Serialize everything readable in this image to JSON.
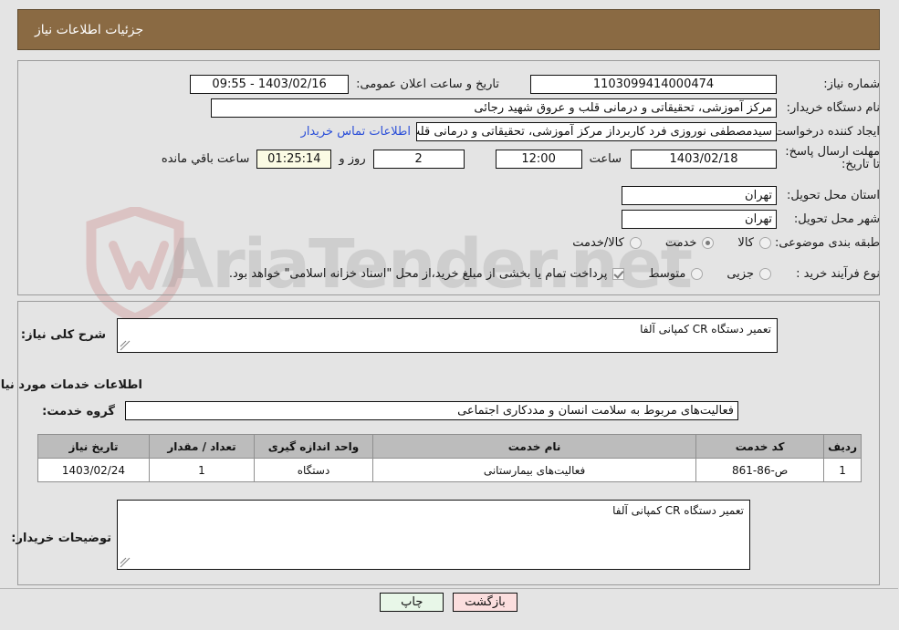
{
  "header": {
    "title": "جزئیات اطلاعات نیاز"
  },
  "colors": {
    "header_bg": "#8a6a43",
    "header_text": "#ffffff",
    "page_bg": "#e4e4e4",
    "link": "#2b4fd8",
    "timer_bg": "#fbfbe4",
    "table_header_bg": "#bcbcbc",
    "print_btn_bg": "#e8f7e8",
    "back_btn_bg": "#fbdede"
  },
  "watermark": {
    "text": "AriaTender.net"
  },
  "top_section": {
    "need_number": {
      "label": "شماره نیاز:",
      "value": "1103099414000474"
    },
    "public_announcement": {
      "label": "تاریخ و ساعت اعلان عمومی:",
      "value": "1403/02/16 - 09:55"
    },
    "buyer_org": {
      "label": "نام دستگاه خریدار:",
      "value": "مرکز آموزشی، تحقیقاتی و درمانی قلب و عروق شهید رجائی"
    },
    "request_creator": {
      "label": "ایجاد کننده درخواست:",
      "value": "سیدمصطفی نوروزی فرد کاربرداز مرکز آموزشی، تحقیقاتی و درمانی قلب و عروق",
      "contact_link": "اطلاعات تماس خریدار"
    },
    "deadline": {
      "label": "مهلت ارسال پاسخ: تا تاریخ:",
      "date": "1403/02/18",
      "time_label": "ساعت",
      "time": "12:00",
      "days": "2",
      "days_label": "روز و",
      "timer": "01:25:14",
      "remaining_label": "ساعت باقي مانده"
    },
    "delivery_province": {
      "label": "استان محل تحویل:",
      "value": "تهران"
    },
    "delivery_city": {
      "label": "شهر محل تحویل:",
      "value": "تهران"
    },
    "subject_class": {
      "label": "طبقه بندی موضوعی:",
      "options": [
        {
          "label": "کالا",
          "selected": false
        },
        {
          "label": "خدمت",
          "selected": true
        },
        {
          "label": "کالا/خدمت",
          "selected": false
        }
      ]
    },
    "purchase_process": {
      "label": "نوع فرآیند خرید :",
      "options": [
        {
          "label": "جزیی",
          "selected": false
        },
        {
          "label": "متوسط",
          "selected": false
        }
      ],
      "treasury_checkbox": {
        "checked": true,
        "label": "پرداخت تمام یا بخشی از مبلغ خرید،از محل \"اسناد خزانه اسلامی\" خواهد بود."
      }
    }
  },
  "bottom_section": {
    "general_desc": {
      "label": "شرح کلی نیاز:",
      "value": "تعمیر دستگاه CR کمپانی آلفا"
    },
    "services_heading": "اطلاعات خدمات مورد نیاز",
    "service_group": {
      "label": "گروه خدمت:",
      "value": "فعالیت‌های مربوط به سلامت انسان و مددکاری اجتماعی"
    },
    "table": {
      "columns": [
        "ردیف",
        "کد خدمت",
        "نام خدمت",
        "واحد اندازه گیری",
        "تعداد / مقدار",
        "تاریخ نیاز"
      ],
      "rows": [
        {
          "index": "1",
          "service_code": "ص-86-861",
          "service_name": "فعالیت‌های بیمارستانی",
          "unit": "دستگاه",
          "quantity": "1",
          "need_date": "1403/02/24"
        }
      ]
    },
    "buyer_notes": {
      "label": "توضیحات خریدار:",
      "value": "تعمیر دستگاه CR کمپانی آلفا"
    }
  },
  "footer": {
    "print_label": "چاپ",
    "back_label": "بازگشت"
  }
}
